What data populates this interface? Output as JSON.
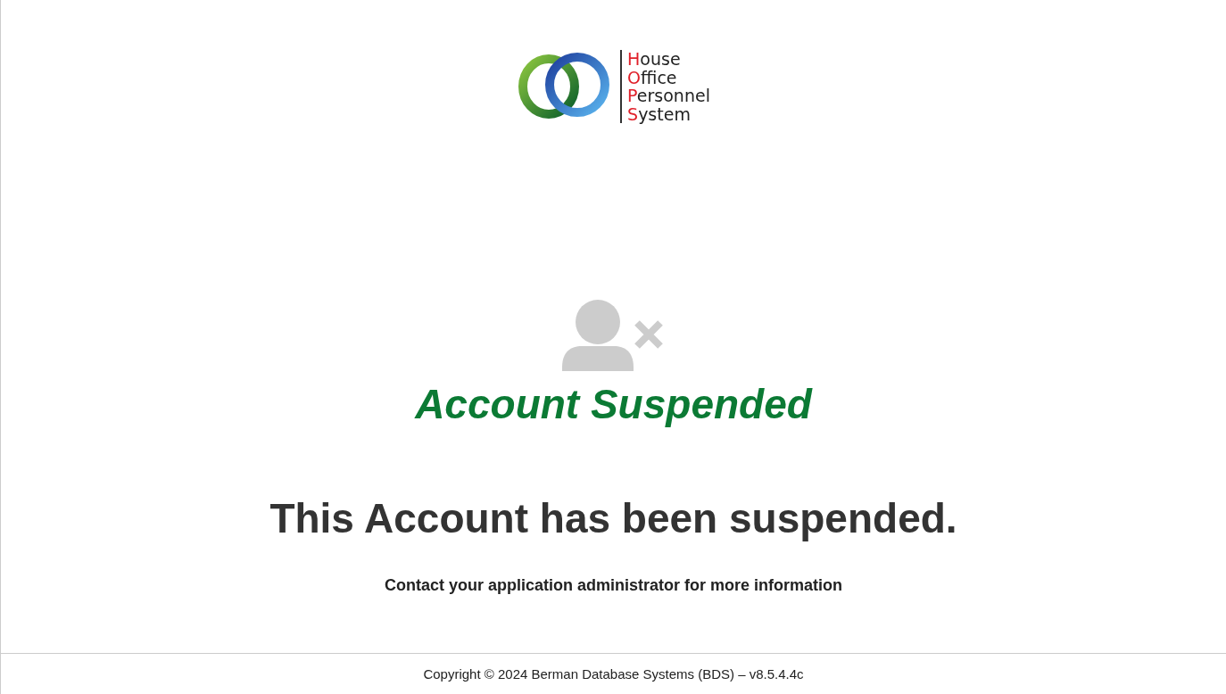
{
  "logo": {
    "lines": [
      "House",
      "Office",
      "Personnel",
      "System"
    ]
  },
  "status": {
    "title": "Account Suspended",
    "heading": "This Account has been suspended.",
    "message": "Contact your application administrator for more information"
  },
  "footer": {
    "copyright": "Copyright © 2024 Berman Database Systems (BDS) – v8.5.4.4c"
  }
}
